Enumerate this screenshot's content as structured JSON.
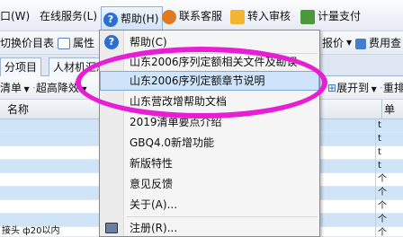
{
  "menubar": {
    "window_label": "口(W)",
    "online_label": "在线服务(L)",
    "help_label": "帮助(H)",
    "contact_label": "联系客服",
    "audit_label": "转入审核",
    "pay_label": "计量支付"
  },
  "toolbar2": {
    "switch_label": "切换价目表",
    "props_label": "属性",
    "price_label": "报价",
    "fee_label": "费用查"
  },
  "tabs": {
    "items": [
      "分项目",
      "人材机汇总"
    ]
  },
  "filterbar": {
    "list_label": "清单",
    "hyper_label": "超高降效",
    "expand_label": "展开到",
    "resort_label": "重排"
  },
  "grid": {
    "name_header": "名称",
    "unit_header": "单位",
    "units": [
      "t",
      "t",
      "t",
      "t",
      "个",
      "个",
      "个",
      "个",
      "个"
    ],
    "last_row_text": "接头 ф20以内"
  },
  "help_menu": {
    "items": [
      "帮助(C)",
      "山东2006序列定额相关文件及勘误",
      "山东2006序列定额章节说明",
      "山东营改增帮助文档",
      "2019清单要点介绍",
      "GBQ4.0新增功能",
      "新版特性",
      "意见反馈",
      "关于(A)...",
      "注册(R)..."
    ],
    "highlighted_index": 2
  },
  "colors": {
    "highlight_bg": "#cfe3fa",
    "annotation": "#e81ed4",
    "row_blue": "#cfe4f7"
  }
}
